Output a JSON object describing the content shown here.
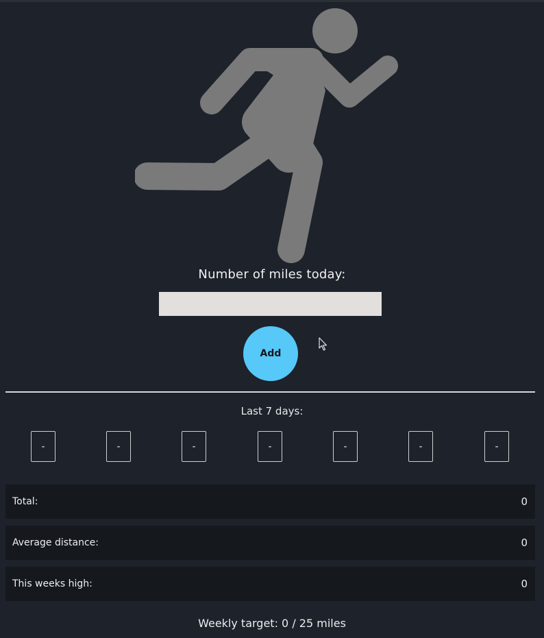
{
  "hero": {
    "icon": "running-person-icon",
    "icon_color": "#7a7a7a"
  },
  "entry": {
    "label": "Number of miles today:",
    "input_value": "",
    "add_label": "Add",
    "add_color": "#56c9f8"
  },
  "history": {
    "label": "Last 7 days:",
    "days": [
      "-",
      "-",
      "-",
      "-",
      "-",
      "-",
      "-"
    ]
  },
  "stats": {
    "total_label": "Total:",
    "total_value": "0",
    "average_label": "Average distance:",
    "average_value": "0",
    "high_label": "This weeks high:",
    "high_value": "0"
  },
  "target": {
    "text": "Weekly target: 0 / 25 miles"
  }
}
